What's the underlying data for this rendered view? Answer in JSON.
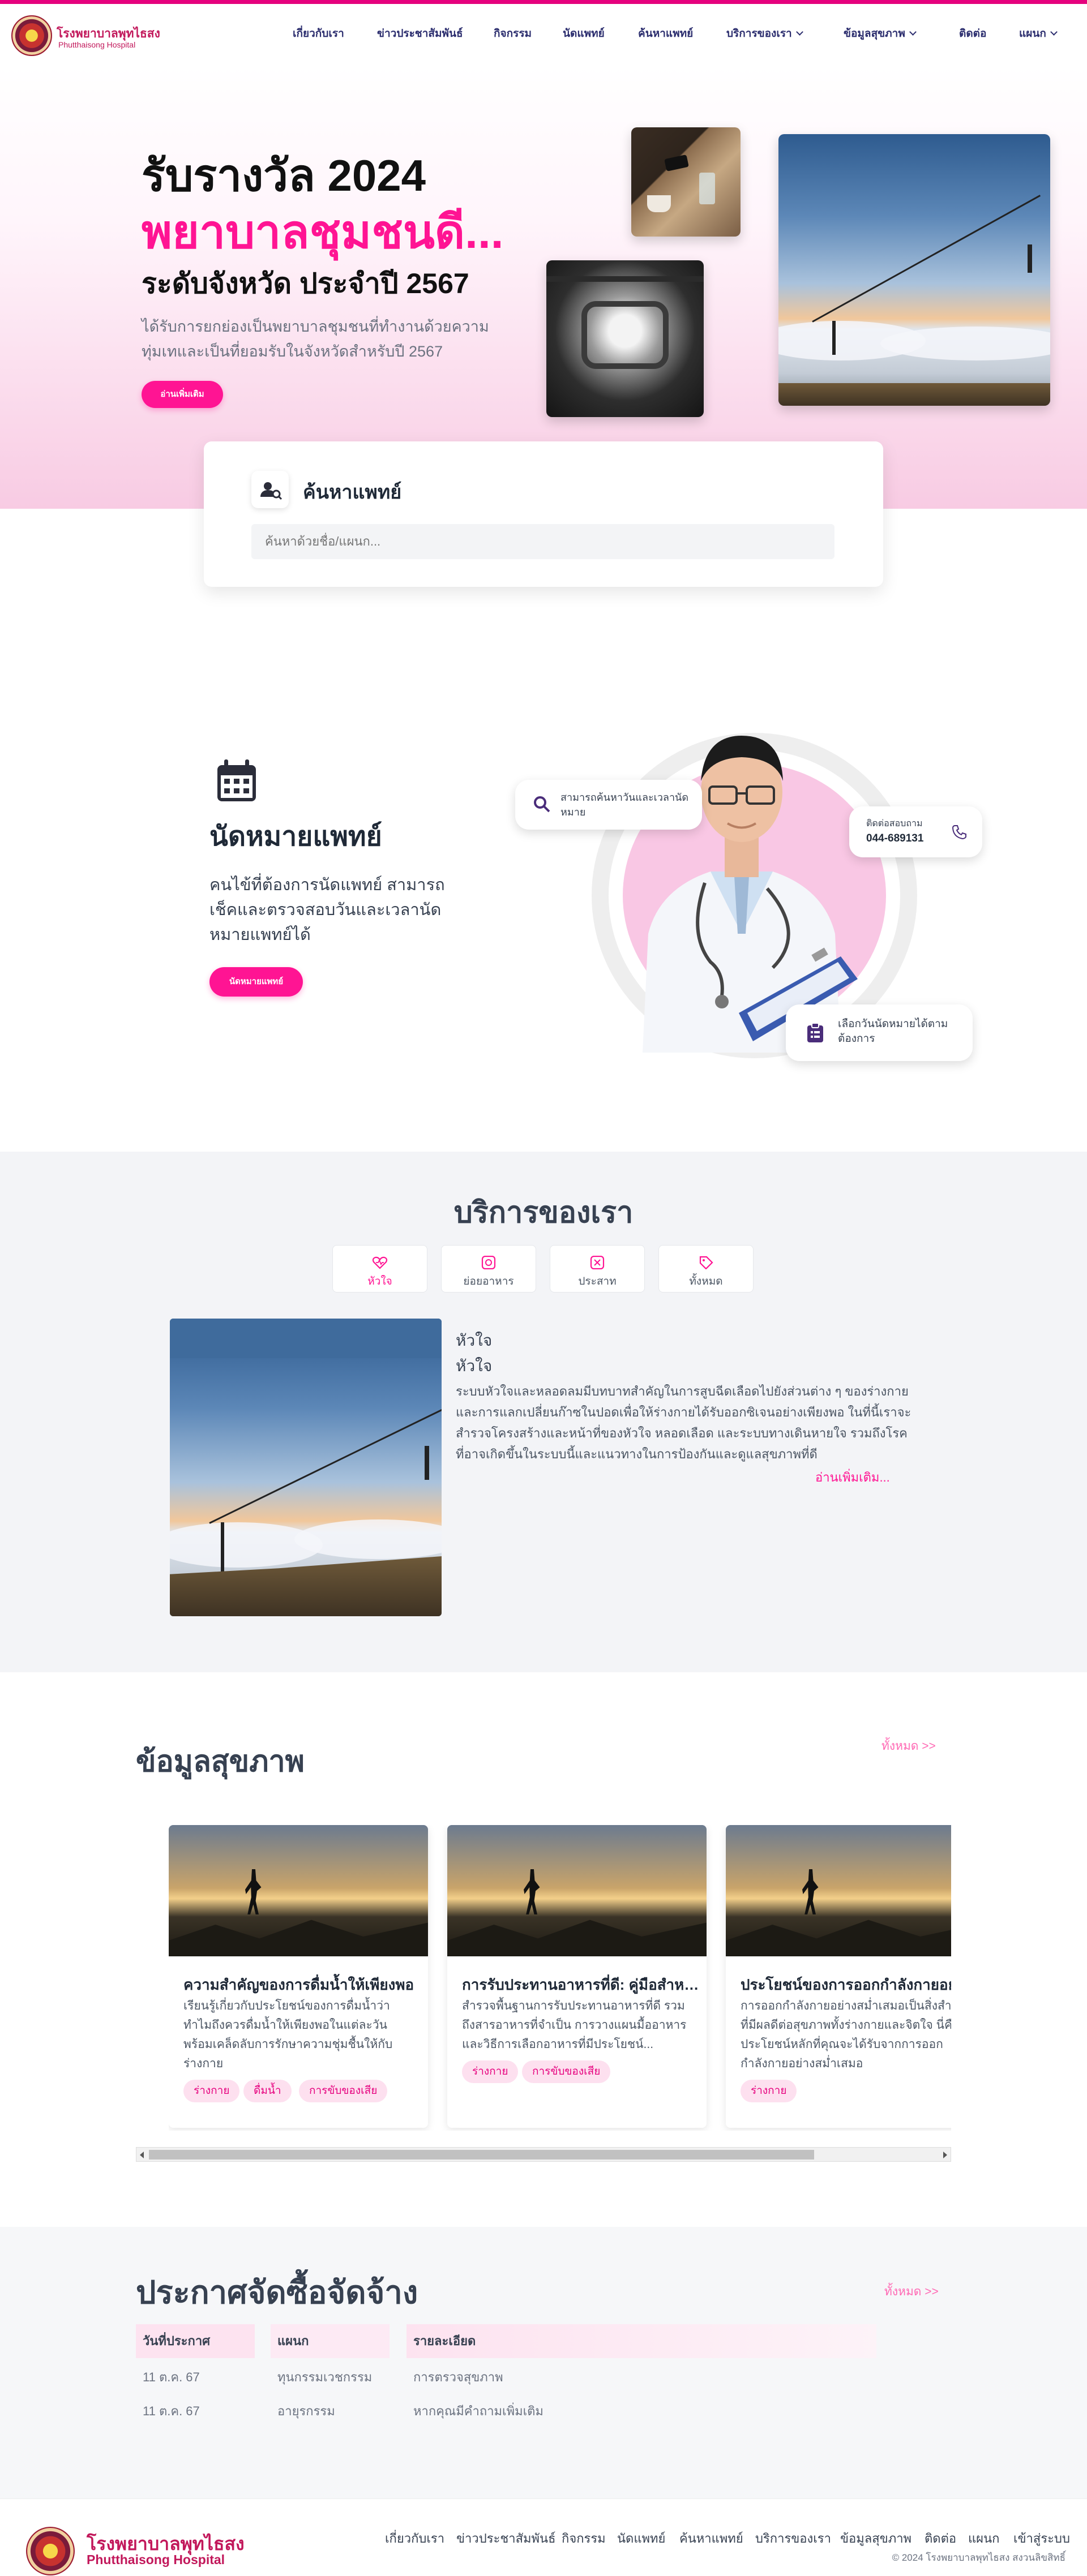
{
  "brand": {
    "name_th": "โรงพยาบาลพุทไธสง",
    "name_en": "Phutthaisong Hospital"
  },
  "nav": {
    "items": [
      {
        "label": "เกี่ยวกับเรา",
        "dropdown": false
      },
      {
        "label": "ข่าวประชาสัมพันธ์",
        "dropdown": false
      },
      {
        "label": "กิจกรรม",
        "dropdown": false
      },
      {
        "label": "นัดแพทย์",
        "dropdown": false
      },
      {
        "label": "ค้นหาแพทย์",
        "dropdown": false
      },
      {
        "label": "บริการของเรา",
        "dropdown": true
      },
      {
        "label": "ข้อมูลสุขภาพ",
        "dropdown": true
      },
      {
        "label": "ติดต่อ",
        "dropdown": false
      },
      {
        "label": "แผนก",
        "dropdown": true
      }
    ]
  },
  "hero": {
    "line1": "รับรางวัล 2024",
    "line2": "พยาบาลชุมชนดี...",
    "line3": "ระดับจังหวัด ประจำปี 2567",
    "description": "ได้รับการยกย่องเป็นพยาบาลชุมชนที่ทำงานด้วยความทุ่มเทและเป็นที่ยอมรับในจังหวัดสำหรับปี 2567",
    "button": "อ่านเพิ่มเติม"
  },
  "doctor_search": {
    "title": "ค้นหาแพทย์",
    "placeholder": "ค้นหาด้วยชื่อ/แผนก..."
  },
  "appointment": {
    "title": "นัดหมายแพทย์",
    "description": "คนไข้ที่ต้องการนัดแพทย์ สามารถเช็คและตรวจสอบวันและเวลานัดหมายแพทย์ได้",
    "button": "นัดหมายแพทย์",
    "float_search": "สามารถค้นหาวันและเวลานัดหมาย",
    "float_contact_label": "ติดต่อสอบถาม",
    "float_contact_phone": "044-689131",
    "float_choose": "เลือกวันนัดหมายได้ตามต้องการ"
  },
  "services": {
    "title": "บริการของเรา",
    "tabs": [
      {
        "label": "หัวใจ",
        "icon": "heart-icon",
        "active": true
      },
      {
        "label": "ย่อยอาหาร",
        "icon": "digestion-icon",
        "active": false
      },
      {
        "label": "ประสาท",
        "icon": "brain-icon",
        "active": false
      },
      {
        "label": "ทั้งหมด",
        "icon": "tag-icon",
        "active": false
      }
    ],
    "detail": {
      "heading": "หัวใจ",
      "subheading": "หัวใจ",
      "body": "ระบบหัวใจและหลอดลมมีบทบาทสำคัญในการสูบฉีดเลือดไปยังส่วนต่าง ๆ ของร่างกายและการแลกเปลี่ยนก๊าซในปอดเพื่อให้ร่างกายได้รับออกซิเจนอย่างเพียงพอ ในที่นี้เราจะสำรวจโครงสร้างและหน้าที่ของหัวใจ หลอดเลือด และระบบทางเดินหายใจ รวมถึงโรคที่อาจเกิดขึ้นในระบบนี้และแนวทางในการป้องกันและดูแลสุขภาพที่ดี",
      "more": "อ่านเพิ่มเติม..."
    }
  },
  "health": {
    "title": "ข้อมูลสุขภาพ",
    "see_all": "ทั้งหมด >>",
    "cards": [
      {
        "title": "ความสำคัญของการดื่มน้ำให้เพียงพอ",
        "desc": "เรียนรู้เกี่ยวกับประโยชน์ของการดื่มน้ำว่าทำไมถึงควรดื่มน้ำให้เพียงพอในแต่ละวัน พร้อมเคล็ดลับการรักษาความชุ่มชื้นให้กับร่างกาย",
        "tags": [
          "ร่างกาย",
          "ดื่มน้ำ",
          "การขับของเสีย"
        ]
      },
      {
        "title": "การรับประทานอาหารที่ดี: คู่มือสำหรับ...",
        "desc": "สำรวจพื้นฐานการรับประทานอาหารที่ดี รวมถึงสารอาหารที่จำเป็น การวางแผนมื้ออาหาร และวิธีการเลือกอาหารที่มีประโยชน์...",
        "tags": [
          "ร่างกาย",
          "การขับของเสีย"
        ]
      },
      {
        "title": "ประโยชน์ของการออกกำลังกายอย่างสม่ำเสมอ",
        "desc": "การออกกำลังกายอย่างสม่ำเสมอเป็นสิ่งสำคัญที่มีผลดีต่อสุขภาพทั้งร่างกายและจิตใจ นี่คือประโยชน์หลักที่คุณจะได้รับจากการออกกำลังกายอย่างสม่ำเสมอ",
        "tags": [
          "ร่างกาย"
        ]
      }
    ]
  },
  "procurement": {
    "title": "ประกาศจัดซื้อจัดจ้าง",
    "see_all": "ทั้งหมด >>",
    "headers": [
      "วันที่ประกาศ",
      "แผนก",
      "รายละเอียด"
    ],
    "rows": [
      [
        "11 ต.ค. 67",
        "ทุนกรรมเวชกรรม",
        "การตรวจสุขภาพ"
      ],
      [
        "11 ต.ค. 67",
        "อายุรกรรม",
        "หากคุณมีคำถามเพิ่มเติม"
      ]
    ]
  },
  "footer": {
    "name_th": "โรงพยาบาลพุทไธสง",
    "name_en": "Phutthaisong Hospital",
    "links": [
      "เกี่ยวกับเรา",
      "ข่าวประชาสัมพันธ์",
      "กิจกรรม",
      "นัดแพทย์",
      "ค้นหาแพทย์",
      "บริการของเรา",
      "ข้อมูลสุขภาพ",
      "ติดต่อ",
      "แผนก",
      "เข้าสู่ระบบ"
    ],
    "copyright": "© 2024 โรงพยาบาลพุทไธสง สงวนลิขสิทธิ์"
  },
  "colors": {
    "accent": "#ff1493",
    "brand": "#c2185b",
    "nav_text": "#2b2d6e"
  }
}
